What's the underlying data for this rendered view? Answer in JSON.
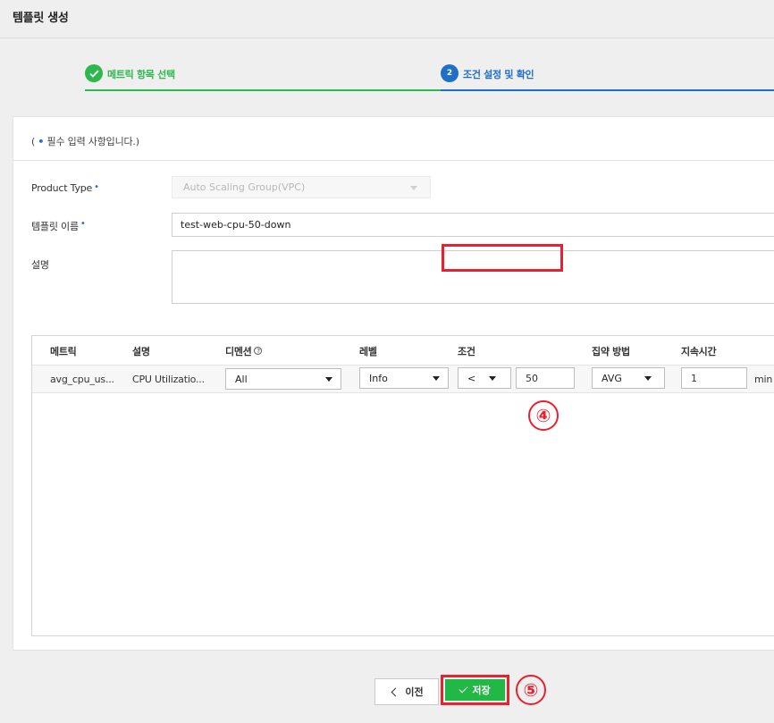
{
  "page": {
    "title": "템플릿 생성"
  },
  "stepper": {
    "step1": {
      "label": "메트릭 항목 선택",
      "status": "completed"
    },
    "step2": {
      "number": "2",
      "label": "조건 설정 및 확인",
      "status": "active"
    }
  },
  "form": {
    "required_note_prefix": "( ",
    "required_note_dot": "•",
    "required_note_text": " 필수 입력 사항입니다.)",
    "required_mark": "•",
    "product_type": {
      "label": "Product Type",
      "value": "Auto Scaling Group(VPC)"
    },
    "template_name": {
      "label": "템플릿 이름",
      "value": "test-web-cpu-50-down"
    },
    "description": {
      "label": "설명",
      "value": ""
    }
  },
  "table": {
    "headers": {
      "metric": "메트릭",
      "description": "설명",
      "dimension": "디멘션",
      "dimension_help": "?",
      "level": "레벨",
      "condition": "조건",
      "aggregation": "집약 방법",
      "duration": "지속시간"
    },
    "rows": [
      {
        "metric": "avg_cpu_us...",
        "description": "CPU Utilizatio...",
        "dimension": "All",
        "level": "Info",
        "operator": "<",
        "threshold": "50",
        "aggregation": "AVG",
        "duration": "1",
        "duration_unit": "min"
      }
    ]
  },
  "annotations": {
    "marker4": "④",
    "marker5": "⑤"
  },
  "footer": {
    "prev_label": "이전",
    "save_label": "저장"
  },
  "colors": {
    "success": "#2db84d",
    "primary": "#1f6fc8",
    "highlight": "#e8202f",
    "save_button": "#22b845"
  }
}
